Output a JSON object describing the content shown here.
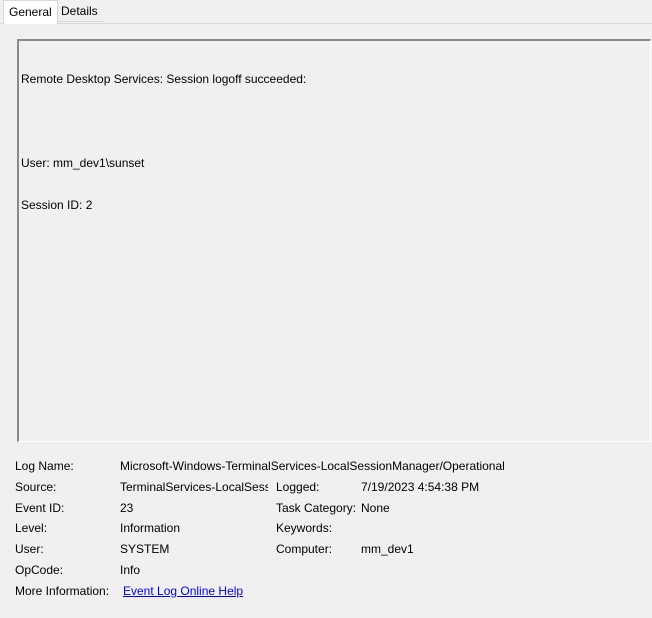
{
  "tabs": {
    "general": "General",
    "details": "Details"
  },
  "description": {
    "lines": [
      "Remote Desktop Services: Session logoff succeeded:",
      "",
      "User: mm_dev1\\sunset",
      "Session ID: 2"
    ]
  },
  "fields": {
    "log_name": {
      "label": "Log Name:",
      "value": "Microsoft-Windows-TerminalServices-LocalSessionManager/Operational"
    },
    "source": {
      "label": "Source:",
      "value": "TerminalServices-LocalSessionManager"
    },
    "logged": {
      "label": "Logged:",
      "value": "7/19/2023 4:54:38 PM"
    },
    "event_id": {
      "label": "Event ID:",
      "value": "23"
    },
    "task_category": {
      "label": "Task Category:",
      "value": "None"
    },
    "level": {
      "label": "Level:",
      "value": "Information"
    },
    "keywords": {
      "label": "Keywords:",
      "value": ""
    },
    "user": {
      "label": "User:",
      "value": "SYSTEM"
    },
    "computer": {
      "label": "Computer:",
      "value": "mm_dev1"
    },
    "opcode": {
      "label": "OpCode:",
      "value": "Info"
    },
    "more_information": {
      "label": "More Information:",
      "value": "Event Log Online Help"
    }
  }
}
